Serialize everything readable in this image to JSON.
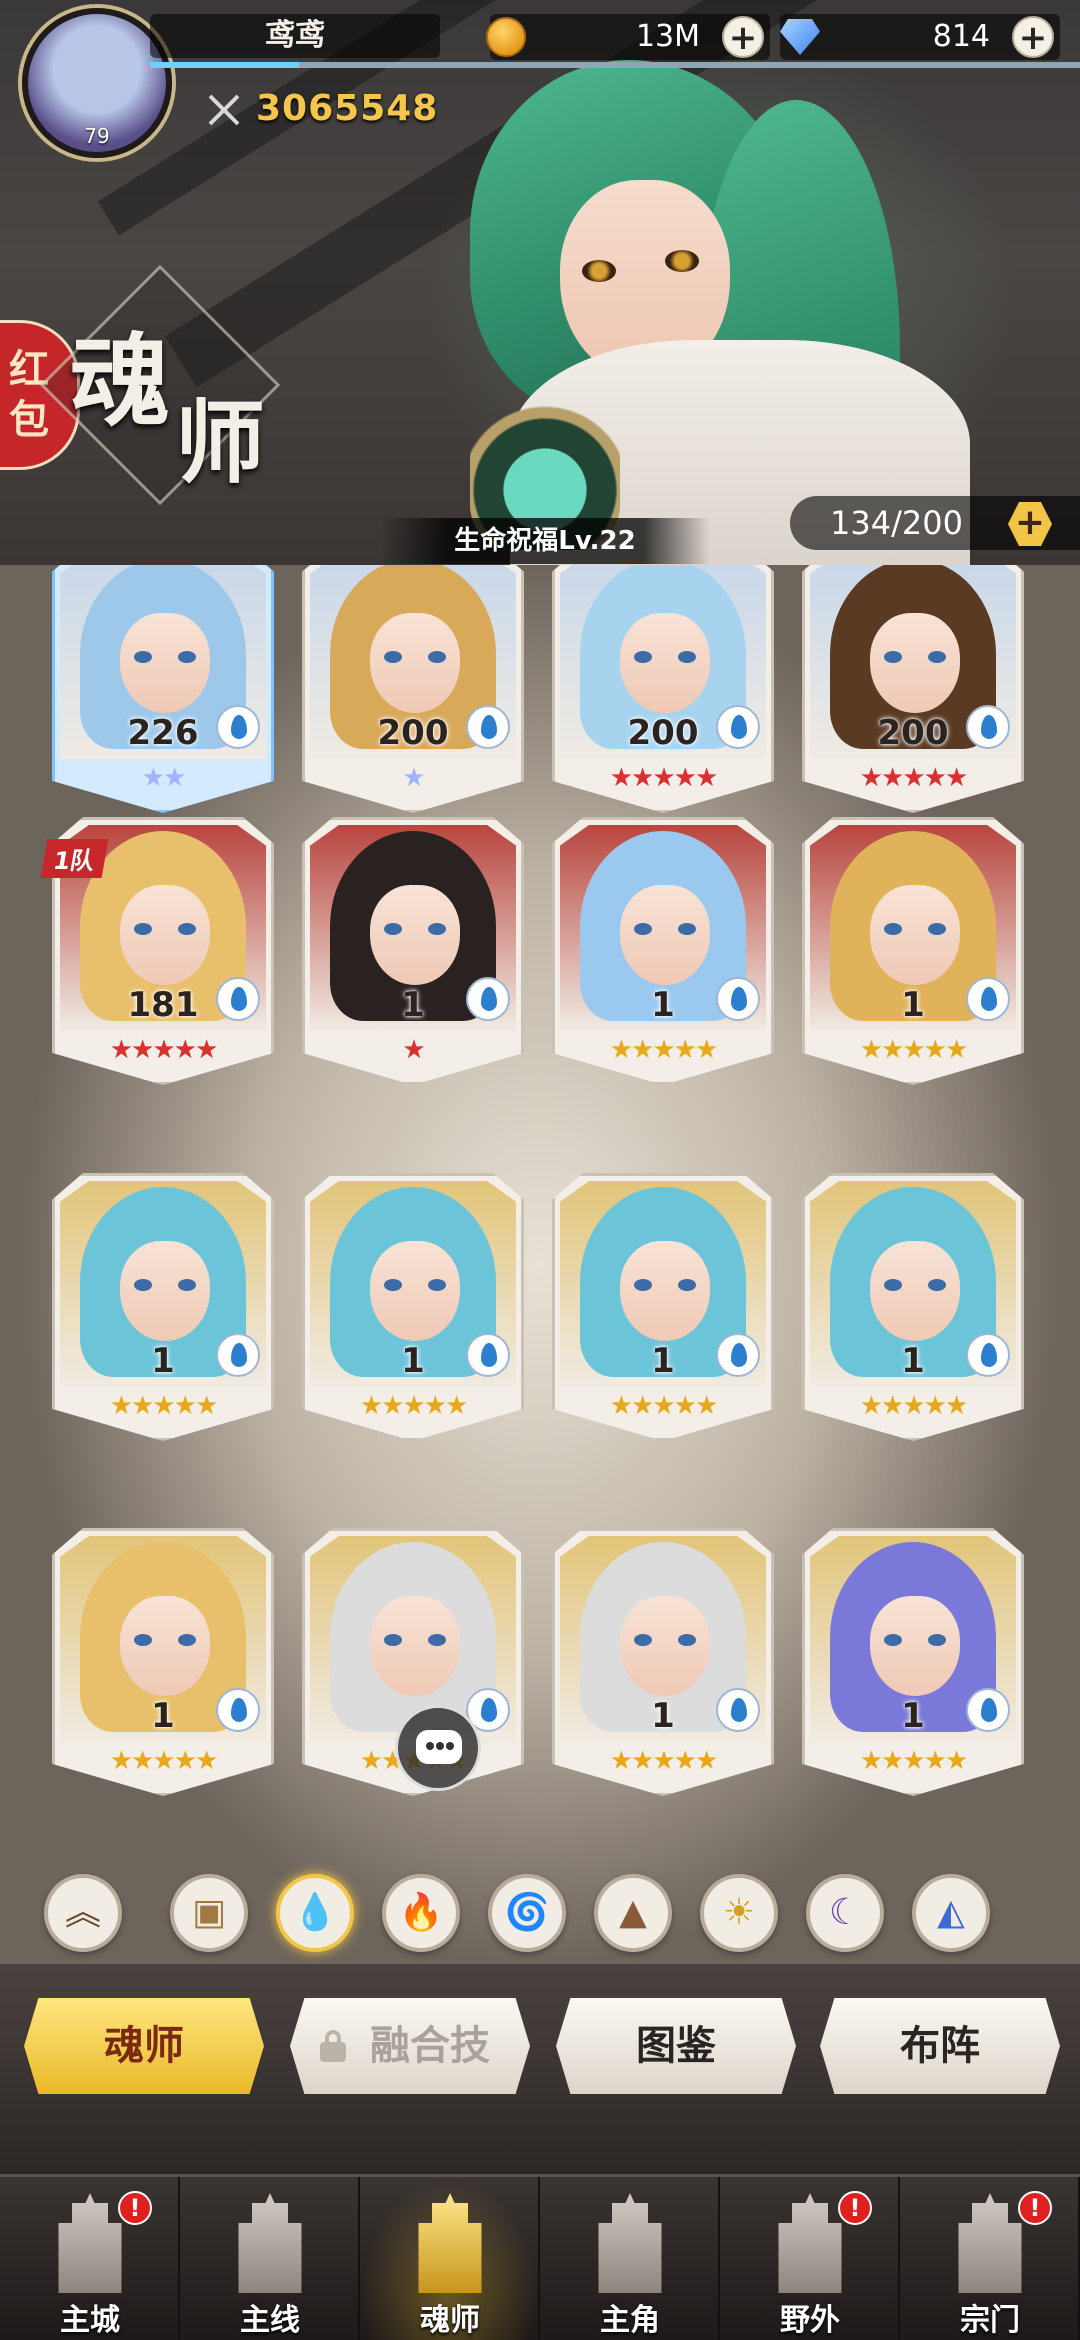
{
  "header": {
    "player_name": "鸢鸢",
    "player_level": "79",
    "gold": "13M",
    "diamonds": "814",
    "combat_power": "3065548",
    "red_packet": "红包",
    "title_char1": "魂",
    "title_char2": "师",
    "blessing": "生命祝福Lv.22",
    "capacity": "134/200"
  },
  "cards": [
    {
      "level": "226",
      "stars": "★★",
      "star_color": "#9fb6ff",
      "hair": "#9ec8ea",
      "selected": true
    },
    {
      "level": "200",
      "stars": "★",
      "star_color": "#9fb6ff",
      "hair": "#d9a95a"
    },
    {
      "level": "200",
      "stars": "★★★★★",
      "star_color": "#d93030",
      "hair": "#a7d3ef"
    },
    {
      "level": "200",
      "stars": "★★★★★",
      "star_color": "#d93030",
      "hair": "#5a3a22"
    },
    {
      "level": "181",
      "stars": "★★★★★",
      "star_color": "#d93030",
      "hair": "#e8bf6a",
      "team": "1队"
    },
    {
      "level": "1",
      "stars": "★",
      "star_color": "#d93030",
      "hair": "#2a2220"
    },
    {
      "level": "1",
      "stars": "★★★★★",
      "star_color": "#e8a81c",
      "hair": "#9ac8ee"
    },
    {
      "level": "1",
      "stars": "★★★★★",
      "star_color": "#e8a81c",
      "hair": "#e0b25a"
    },
    {
      "level": "1",
      "stars": "★★★★★",
      "star_color": "#e8a81c",
      "hair": "#6cc4d8"
    },
    {
      "level": "1",
      "stars": "★★★★★",
      "star_color": "#e8a81c",
      "hair": "#6cc4d8"
    },
    {
      "level": "1",
      "stars": "★★★★★",
      "star_color": "#e8a81c",
      "hair": "#6cc4d8"
    },
    {
      "level": "1",
      "stars": "★★★★★",
      "star_color": "#e8a81c",
      "hair": "#6cc4d8"
    },
    {
      "level": "1",
      "stars": "★★★★★",
      "star_color": "#e8a81c",
      "hair": "#e8bf6a"
    },
    {
      "level": "",
      "stars": "★★★★★",
      "star_color": "#e8a81c",
      "hair": "#dcdcdc"
    },
    {
      "level": "1",
      "stars": "★★★★★",
      "star_color": "#e8a81c",
      "hair": "#dcdcdc"
    },
    {
      "level": "1",
      "stars": "★★★★★",
      "star_color": "#e8a81c",
      "hair": "#7a78d8"
    }
  ],
  "filters": [
    {
      "name": "rank-filter",
      "icon": "chevrons-up-icon",
      "glyph": "︽",
      "color": "#6a4a2a"
    },
    {
      "name": "all-filter",
      "icon": "box-icon",
      "glyph": "▣",
      "color": "#a07a40"
    },
    {
      "name": "water-filter",
      "icon": "water-drop-icon",
      "glyph": "💧",
      "color": "#2c7fcf",
      "active": true
    },
    {
      "name": "fire-filter",
      "icon": "fire-icon",
      "glyph": "🔥",
      "color": "#d33a2a"
    },
    {
      "name": "wind-filter",
      "icon": "wind-icon",
      "glyph": "🌀",
      "color": "#3aa86a"
    },
    {
      "name": "earth-filter",
      "icon": "mountain-icon",
      "glyph": "▲",
      "color": "#8a5a3a"
    },
    {
      "name": "light-filter",
      "icon": "sun-icon",
      "glyph": "☀",
      "color": "#d8a020"
    },
    {
      "name": "dark-filter",
      "icon": "moon-icon",
      "glyph": "☾",
      "color": "#6a4ab8"
    },
    {
      "name": "special-filter",
      "icon": "triangle-icon",
      "glyph": "◭",
      "color": "#3a6ad8"
    }
  ],
  "tabs": [
    {
      "label": "魂师",
      "active": true
    },
    {
      "label": "融合技",
      "locked": true
    },
    {
      "label": "图鉴"
    },
    {
      "label": "布阵"
    }
  ],
  "nav": [
    {
      "label": "主城",
      "icon": "castle-icon",
      "badge": "!"
    },
    {
      "label": "主线",
      "icon": "mainline-icon"
    },
    {
      "label": "魂师",
      "icon": "soul-master-icon",
      "active": true
    },
    {
      "label": "主角",
      "icon": "hero-icon"
    },
    {
      "label": "野外",
      "icon": "shield-icon",
      "badge": "!"
    },
    {
      "label": "宗门",
      "icon": "sect-icon",
      "badge": "!"
    }
  ]
}
